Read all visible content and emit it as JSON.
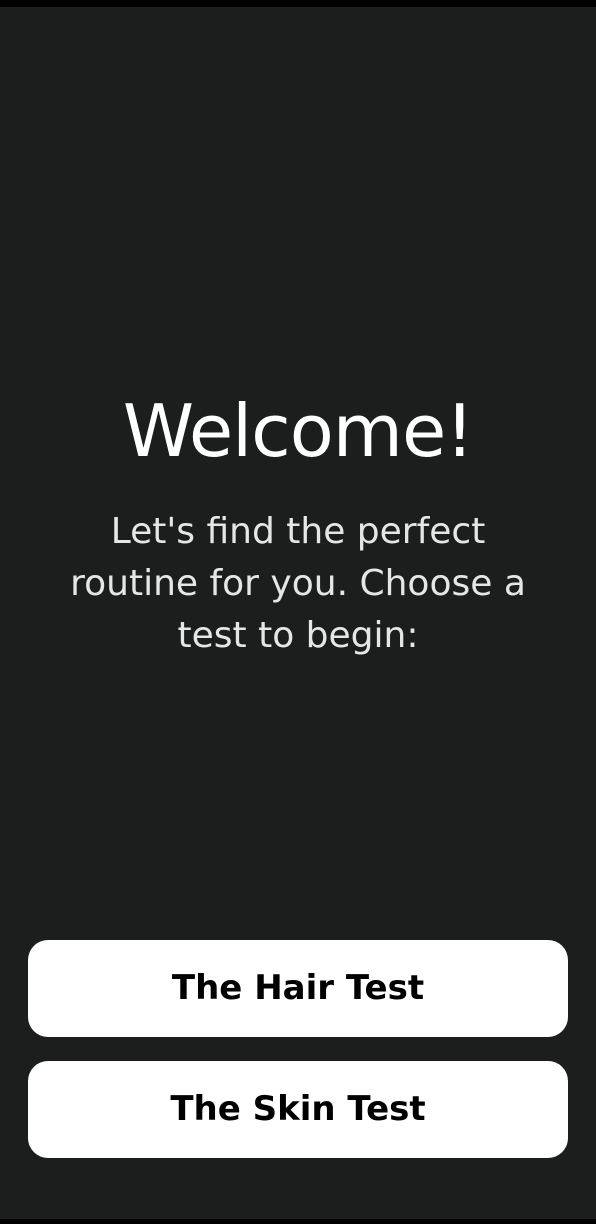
{
  "welcome": {
    "title": "Welcome!",
    "subtitle": "Let's find the perfect routine for you. Choose a test to begin:"
  },
  "tests": {
    "hair_label": "The Hair Test",
    "skin_label": "The Skin Test"
  },
  "colors": {
    "background": "#1c1e1e",
    "button_background": "#ffffff",
    "button_text": "#000000",
    "title_text": "#ffffff"
  }
}
